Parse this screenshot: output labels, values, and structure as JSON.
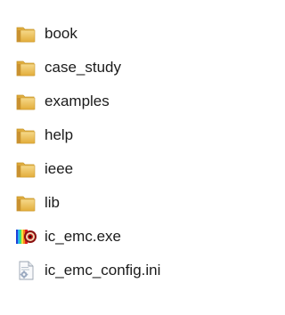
{
  "items": [
    {
      "name": "book",
      "icon": "folder-icon"
    },
    {
      "name": "case_study",
      "icon": "folder-icon"
    },
    {
      "name": "examples",
      "icon": "folder-icon"
    },
    {
      "name": "help",
      "icon": "folder-icon"
    },
    {
      "name": "ieee",
      "icon": "folder-icon"
    },
    {
      "name": "lib",
      "icon": "folder-icon"
    },
    {
      "name": "ic_emc.exe",
      "icon": "application-icon"
    },
    {
      "name": "ic_emc_config.ini",
      "icon": "config-file-icon"
    }
  ],
  "colors": {
    "folder_body": "#e8b94a",
    "folder_front": "#f3cf6a",
    "folder_edge": "#c9962a",
    "text": "#1b1b1b"
  }
}
